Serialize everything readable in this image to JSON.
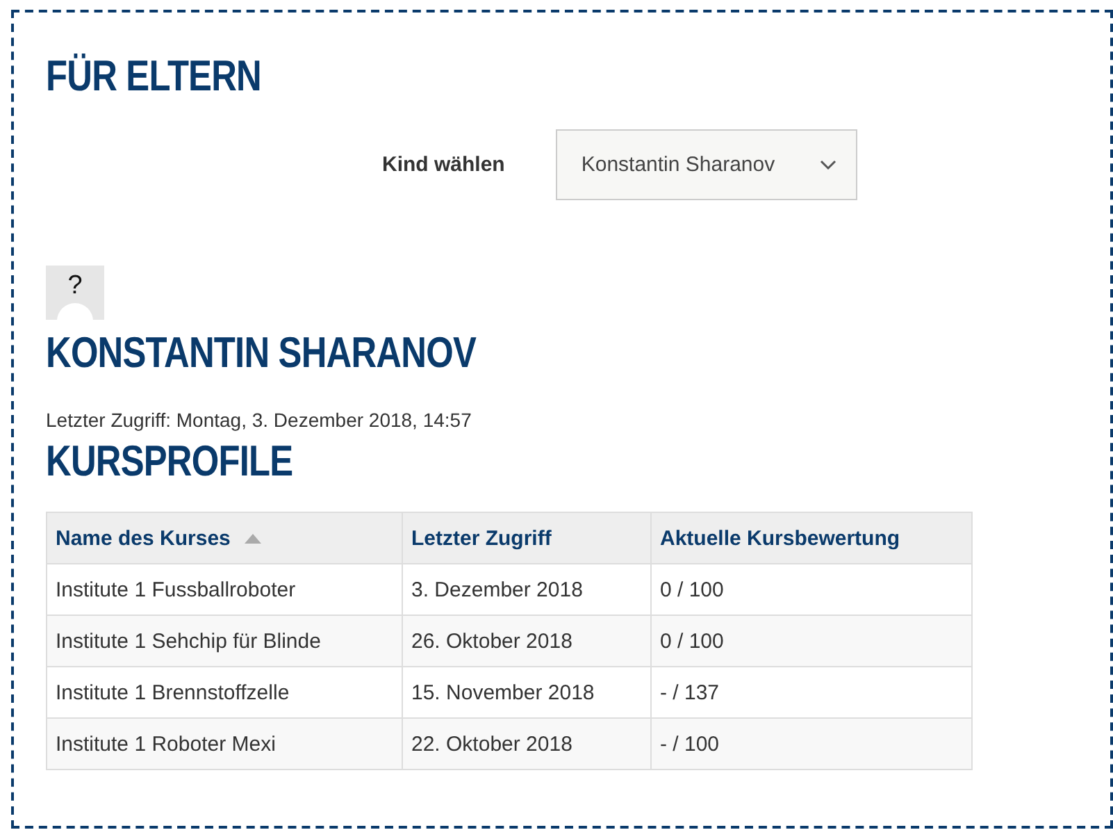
{
  "title": "FÜR ELTERN",
  "child_select": {
    "label": "Kind wählen",
    "value": "Konstantin Sharanov"
  },
  "profile": {
    "avatar_alt": "?",
    "name": "KONSTANTIN SHARANOV",
    "last_access": "Letzter Zugriff: Montag, 3. Dezember 2018, 14:57"
  },
  "courses": {
    "title": "KURSPROFILE",
    "columns": [
      {
        "label": "Name des Kurses",
        "sorted": true
      },
      {
        "label": "Letzter Zugriff",
        "sorted": false
      },
      {
        "label": "Aktuelle Kursbewertung",
        "sorted": false
      }
    ],
    "rows": [
      [
        "Institute 1 Fussballroboter",
        "3. Dezember 2018",
        "0 / 100"
      ],
      [
        "Institute 1 Sehchip für Blinde",
        "26. Oktober 2018",
        "0 / 100"
      ],
      [
        "Institute 1 Brennstoffzelle",
        "15. November 2018",
        "- / 137"
      ],
      [
        "Institute 1 Roboter Mexi",
        "22. Oktober 2018",
        "- / 100"
      ]
    ]
  }
}
